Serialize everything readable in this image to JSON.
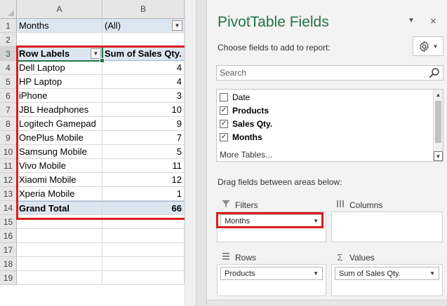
{
  "sheet": {
    "columns": [
      "A",
      "B"
    ],
    "rows": [
      "1",
      "2",
      "3",
      "4",
      "5",
      "6",
      "7",
      "8",
      "9",
      "10",
      "11",
      "12",
      "13",
      "14",
      "15",
      "16",
      "17",
      "18",
      "19"
    ],
    "report_filter": {
      "label": "Months",
      "value": "(All)"
    },
    "header": {
      "row_labels": "Row Labels",
      "sum_label": "Sum of Sales Qty."
    },
    "data": [
      {
        "label": "Dell Laptop",
        "value": "4"
      },
      {
        "label": "HP Laptop",
        "value": "4"
      },
      {
        "label": "iPhone",
        "value": "3"
      },
      {
        "label": "JBL Headphones",
        "value": "10"
      },
      {
        "label": "Logitech Gamepad",
        "value": "9"
      },
      {
        "label": "OnePlus Mobile",
        "value": "7"
      },
      {
        "label": "Samsung Mobile",
        "value": "5"
      },
      {
        "label": "Vivo Mobile",
        "value": "11"
      },
      {
        "label": "Xiaomi Mobile",
        "value": "12"
      },
      {
        "label": "Xperia Mobile",
        "value": "1"
      }
    ],
    "grand_total": {
      "label": "Grand Total",
      "value": "66"
    }
  },
  "panel": {
    "title": "PivotTable Fields",
    "close_glyph": "×",
    "menu_glyph": "▼",
    "subtitle": "Choose fields to add to report:",
    "gear_icon": "gear-icon",
    "search_placeholder": "Search",
    "fields": [
      {
        "name": "Date",
        "checked": false
      },
      {
        "name": "Products",
        "checked": true
      },
      {
        "name": "Sales Qty.",
        "checked": true
      },
      {
        "name": "Months",
        "checked": true
      }
    ],
    "more_tables": "More Tables...",
    "drag_hint": "Drag fields between areas below:",
    "areas": {
      "filters": {
        "label": "Filters",
        "items": [
          "Months"
        ]
      },
      "columns": {
        "label": "Columns",
        "items": []
      },
      "rows": {
        "label": "Rows",
        "items": [
          "Products"
        ]
      },
      "values": {
        "label": "Values",
        "items": [
          "Sum of Sales Qty."
        ]
      }
    }
  },
  "colors": {
    "accent_green": "#217346",
    "highlight_red": "#d81e1e",
    "pivot_header_blue": "#dce6f1"
  }
}
